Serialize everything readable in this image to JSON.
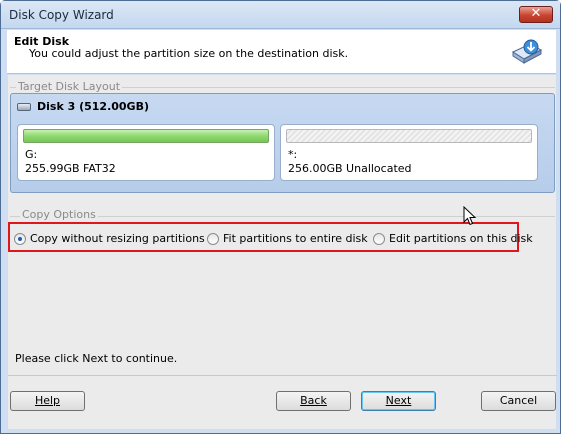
{
  "window": {
    "title": "Disk Copy Wizard",
    "close_label": "✕"
  },
  "header": {
    "title": "Edit Disk",
    "subtitle": "You could adjust the partition size on the destination disk.",
    "icon": "disk-download-icon"
  },
  "target_disk": {
    "group_label": "Target Disk Layout",
    "disk_label": "Disk 3 (512.00GB)",
    "partitions": [
      {
        "label": "G:",
        "info": "255.99GB FAT32",
        "kind": "used",
        "fill": 1.0
      },
      {
        "label": "*:",
        "info": "256.00GB Unallocated",
        "kind": "unallocated",
        "fill": 0.0
      }
    ]
  },
  "copy_options": {
    "group_label": "Copy Options",
    "selected": 0,
    "options": [
      "Copy without resizing partitions",
      "Fit partitions to entire disk",
      "Edit partitions on this disk"
    ]
  },
  "status_text": "Please click Next to continue.",
  "buttons": {
    "help": "Help",
    "back": "Back",
    "next": "Next",
    "cancel": "Cancel"
  },
  "colors": {
    "highlight_border": "#e0161b",
    "used_partition": "#8fd870",
    "disk_panel": "#c7d9f1"
  }
}
